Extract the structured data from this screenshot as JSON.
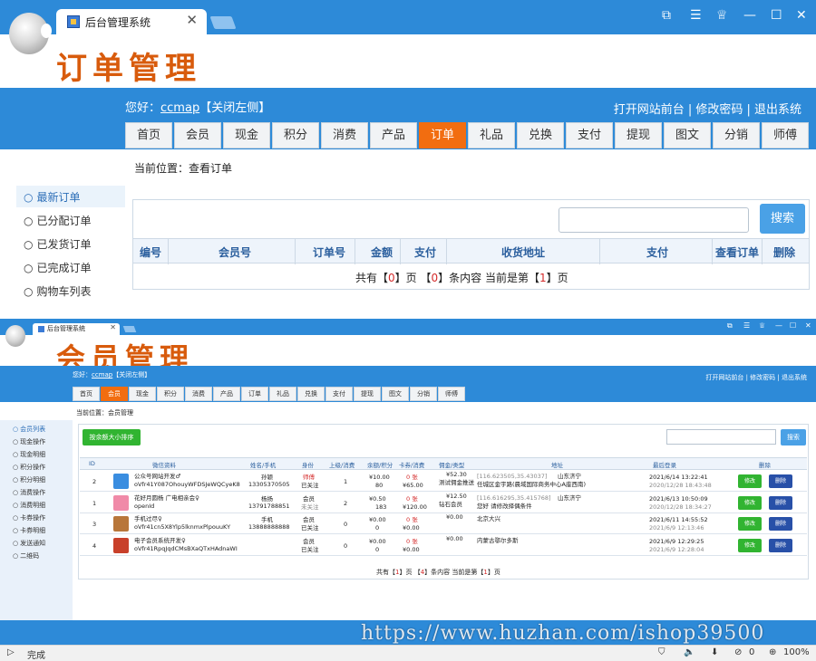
{
  "window1": {
    "tab_title": "后台管理系统",
    "brand_title": "订单管理",
    "greeting_prefix": "您好：",
    "username": "ccmap",
    "close_left": "【关闭左侧】",
    "header_links": "打开网站前台 | 修改密码 | 退出系统",
    "menu": [
      "首页",
      "会员",
      "现金",
      "积分",
      "消费",
      "产品",
      "订单",
      "礼品",
      "兑换",
      "支付",
      "提现",
      "图文",
      "分销",
      "师傅"
    ],
    "active_menu": "订单",
    "breadcrumb": "当前位置：查看订单",
    "sidebar": [
      "最新订单",
      "已分配订单",
      "已发货订单",
      "已完成订单",
      "购物车列表"
    ],
    "search_button": "搜索",
    "table_headers": [
      "编号",
      "会员号",
      "订单号",
      "金额",
      "支付",
      "收货地址",
      "支付",
      "查看订单",
      "删除"
    ],
    "pager": {
      "prefix": "共有【",
      "pages": "0",
      "mid1": "】页 【",
      "items": "0",
      "mid2": "】条内容  当前是第【",
      "current": "1",
      "suffix": "】页"
    }
  },
  "window2": {
    "tab_title": "后台管理系统",
    "brand_title": "会员管理",
    "greeting_prefix": "您好：",
    "username": "ccmap",
    "close_left": "【关闭左侧】",
    "header_links": "打开网站前台 | 修改密码 | 退出系统",
    "menu": [
      "首页",
      "会员",
      "现金",
      "积分",
      "消费",
      "产品",
      "订单",
      "礼品",
      "兑换",
      "支付",
      "提现",
      "图文",
      "分销",
      "师傅"
    ],
    "active_menu": "会员",
    "breadcrumb": "当前位置：会员管理",
    "sidebar": [
      "会员列表",
      "现金操作",
      "现金明细",
      "积分操作",
      "积分明细",
      "消费操作",
      "消费明细",
      "卡券操作",
      "卡券明细",
      "发送通知",
      "二维码"
    ],
    "sort_button": "按余额大小排序",
    "search_button": "搜索",
    "table_headers": [
      "ID",
      "微信资料",
      "姓名/手机",
      "身份",
      "上级/消费",
      "余额/积分",
      "卡券/消费",
      "佣金/类型",
      "地址",
      "最后登录",
      "删除"
    ],
    "rows": [
      {
        "id": "2",
        "nick": "公众号网站开发♂",
        "openid": "oVfr41Y087OhouyWFDSJeWQCyeK8",
        "name": "孙颖",
        "phone": "13305370505",
        "role": "师傅",
        "role2": "已关注",
        "parent": "1",
        "balance": "¥10.00",
        "points": "80",
        "coupons": "0 张",
        "consume": "¥65.00",
        "commission": "¥52.30",
        "ctype": "测试佣金推送",
        "ip": "[116.623505,35.43037]",
        "addr1": "山东济宁",
        "addr2": "任城区金宇路(晨域国际商务中心A座西南)",
        "login": "2021/6/14 13:22:41",
        "login2": "2020/12/28 18:43:48",
        "edit": "修改",
        "del": "删除"
      },
      {
        "id": "1",
        "nick": "花好月圆杨 广电相亲会♀",
        "openid": "openId",
        "name": "杨扬",
        "phone": "13791788851",
        "role": "会员",
        "role2": "未关注",
        "parent": "2",
        "balance": "¥0.50",
        "points": "183",
        "coupons": "0 张",
        "consume": "¥120.00",
        "commission": "¥12.50",
        "ctype": "钻石会员",
        "ip": "[116.616295,35.415768]",
        "addr1": "山东济宁",
        "addr2": "您好 请修改择偶条件",
        "login": "2021/6/13 10:50:09",
        "login2": "2020/12/28 18:34:27",
        "edit": "修改",
        "del": "删除"
      },
      {
        "id": "3",
        "nick": "手机过尽♀",
        "openid": "oVfr41cn5X8Ylp5lknmxPlpouuKY",
        "name": "手机",
        "phone": "13888888888",
        "role": "会员",
        "role2": "已关注",
        "parent": "0",
        "balance": "¥0.00",
        "points": "0",
        "coupons": "0 张",
        "consume": "¥0.00",
        "commission": "¥0.00",
        "ctype": "",
        "ip": "",
        "addr1": "北京大兴",
        "addr2": "",
        "login": "2021/6/11 14:55:52",
        "login2": "2021/6/9 12:13:46",
        "edit": "修改",
        "del": "删除"
      },
      {
        "id": "4",
        "nick": "电子会员系统开发♀",
        "openid": "oVfr41RpqJqdCMsBXaQTxHAdnaWI",
        "name": "",
        "phone": "",
        "role": "会员",
        "role2": "已关注",
        "parent": "0",
        "balance": "¥0.00",
        "points": "0",
        "coupons": "0 张",
        "consume": "¥0.00",
        "commission": "¥0.00",
        "ctype": "",
        "ip": "",
        "addr1": "内蒙古鄂尔多斯",
        "addr2": "",
        "login": "2021/6/9 12:29:25",
        "login2": "2021/6/9 12:28:04",
        "edit": "修改",
        "del": "删除"
      }
    ],
    "pager": {
      "prefix": "共有【",
      "pages": "1",
      "mid1": "】页 【",
      "items": "4",
      "mid2": "】条内容  当前是第【",
      "current": "1",
      "suffix": "】页"
    }
  },
  "watermark": "https://www.huzhan.com/ishop39500",
  "status": {
    "text": "完成",
    "badge": "0",
    "zoom": "100%"
  },
  "colors": {
    "primary": "#2d8ad8",
    "active": "#f26d10",
    "green": "#31b431",
    "navy": "#2850a8",
    "brand": "#d85b0c"
  }
}
